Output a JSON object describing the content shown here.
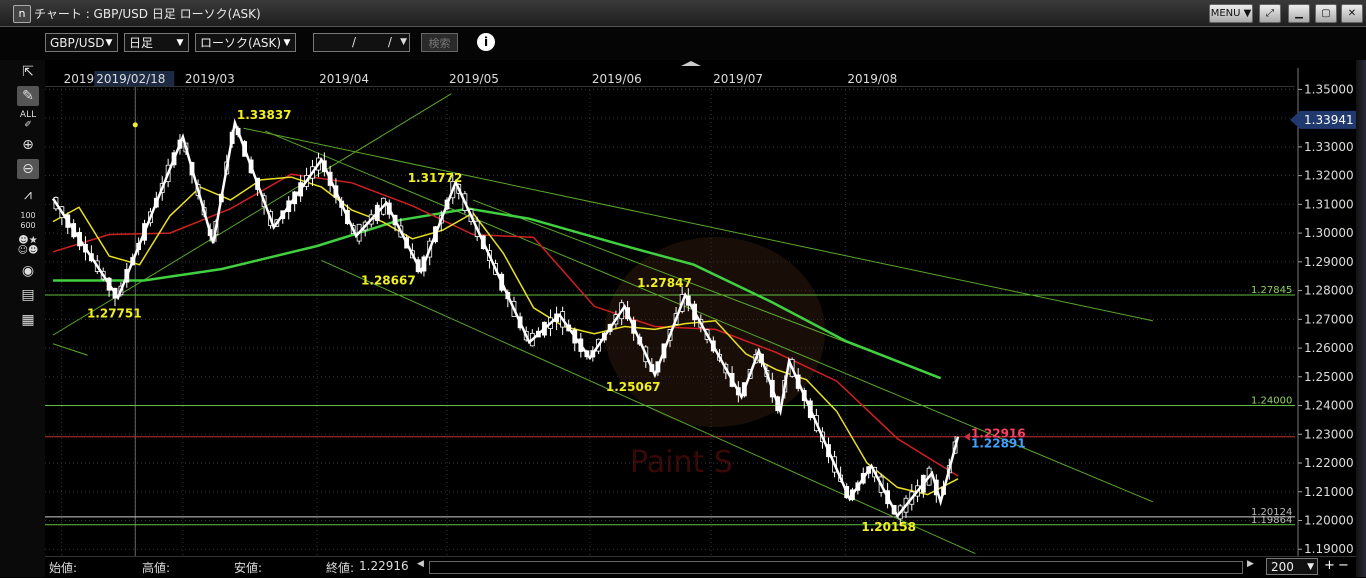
{
  "window": {
    "app_icon": "n",
    "title": "チャート : GBP/USD 日足 ローソク(ASK)",
    "menu_label": "MENU ▼",
    "buttons": [
      "pin-icon",
      "minimize-icon",
      "maximize-icon",
      "close-icon"
    ]
  },
  "toolbar": {
    "pair": "GBP/USD",
    "period": "日足",
    "chart_type": "ローソク(ASK)",
    "date_value": "/ /",
    "search_label": "検索",
    "info_label": "i"
  },
  "tools": [
    "cursor-icon",
    "pen-icon",
    "all-delete-icon",
    "zoom-in-icon",
    "zoom-out-icon",
    "indicator-icon",
    "value-table-icon",
    "compare-icon",
    "view-icon",
    "print-icon",
    "settings-grid-icon"
  ],
  "status": {
    "open_label": "始値:",
    "high_label": "高値:",
    "low_label": "安値:",
    "close_label": "終値:",
    "close_value": "1.22916",
    "zoom_value": "200"
  },
  "colors": {
    "candle": "#ffffff",
    "zigzag": "#ffffff",
    "ma_short": "#e8e020",
    "ma_mid": "#d02020",
    "ma_long": "#40d040",
    "trendline": "#5aa82a",
    "horizontal_line": "#60c040",
    "current_price_line": "#c03030",
    "price_label_bg": "#203a70",
    "peak_label": "#f0f020"
  },
  "chart_data": {
    "type": "candlestick",
    "y_range": [
      1.186,
      1.356
    ],
    "y_ticks": [
      "1.35000",
      "1.34000",
      "1.33000",
      "1.32000",
      "1.31000",
      "1.30000",
      "1.29000",
      "1.28000",
      "1.27000",
      "1.26000",
      "1.25000",
      "1.24000",
      "1.23000",
      "1.22000",
      "1.21000",
      "1.20000",
      "1.19000"
    ],
    "x_labels": [
      {
        "text": "2019",
        "date": "2019-02-01"
      },
      {
        "text": "2019/02/18",
        "date": "2019-02-18",
        "highlight": true
      },
      {
        "text": "2019/03",
        "date": "2019-03-01"
      },
      {
        "text": "2019/04",
        "date": "2019-04-01"
      },
      {
        "text": "2019/05",
        "date": "2019-05-01"
      },
      {
        "text": "2019/06",
        "date": "2019-06-03"
      },
      {
        "text": "2019/07",
        "date": "2019-07-01"
      },
      {
        "text": "2019/08",
        "date": "2019-08-01"
      }
    ],
    "zigzag": [
      {
        "date": "2019-01-30",
        "value": 1.312
      },
      {
        "date": "2019-02-14",
        "value": 1.27751
      },
      {
        "date": "2019-03-01",
        "value": 1.3335
      },
      {
        "date": "2019-03-08",
        "value": 1.2965
      },
      {
        "date": "2019-03-13",
        "value": 1.33837
      },
      {
        "date": "2019-03-22",
        "value": 1.302
      },
      {
        "date": "2019-04-02",
        "value": 1.3255
      },
      {
        "date": "2019-04-10",
        "value": 1.299
      },
      {
        "date": "2019-04-17",
        "value": 1.3105
      },
      {
        "date": "2019-04-25",
        "value": 1.28667
      },
      {
        "date": "2019-05-03",
        "value": 1.31772
      },
      {
        "date": "2019-05-20",
        "value": 1.262
      },
      {
        "date": "2019-05-27",
        "value": 1.2715
      },
      {
        "date": "2019-06-03",
        "value": 1.2565
      },
      {
        "date": "2019-06-11",
        "value": 1.2745
      },
      {
        "date": "2019-06-18",
        "value": 1.25067
      },
      {
        "date": "2019-06-25",
        "value": 1.27847
      },
      {
        "date": "2019-07-08",
        "value": 1.243
      },
      {
        "date": "2019-07-12",
        "value": 1.259
      },
      {
        "date": "2019-07-17",
        "value": 1.238
      },
      {
        "date": "2019-07-19",
        "value": 1.2555
      },
      {
        "date": "2019-08-02",
        "value": 1.2075
      },
      {
        "date": "2019-08-07",
        "value": 1.219
      },
      {
        "date": "2019-08-13",
        "value": 1.20158
      },
      {
        "date": "2019-08-21",
        "value": 1.2165
      },
      {
        "date": "2019-08-23",
        "value": 1.2065
      },
      {
        "date": "2019-08-27",
        "value": 1.22916
      }
    ],
    "ma_short": [
      {
        "date": "2019-01-30",
        "value": 1.304
      },
      {
        "date": "2019-02-05",
        "value": 1.309
      },
      {
        "date": "2019-02-12",
        "value": 1.292
      },
      {
        "date": "2019-02-19",
        "value": 1.289
      },
      {
        "date": "2019-02-26",
        "value": 1.306
      },
      {
        "date": "2019-03-05",
        "value": 1.316
      },
      {
        "date": "2019-03-12",
        "value": 1.3115
      },
      {
        "date": "2019-03-19",
        "value": 1.3185
      },
      {
        "date": "2019-03-26",
        "value": 1.3195
      },
      {
        "date": "2019-04-02",
        "value": 1.316
      },
      {
        "date": "2019-04-09",
        "value": 1.308
      },
      {
        "date": "2019-04-16",
        "value": 1.304
      },
      {
        "date": "2019-04-23",
        "value": 1.298
      },
      {
        "date": "2019-04-30",
        "value": 1.301
      },
      {
        "date": "2019-05-07",
        "value": 1.307
      },
      {
        "date": "2019-05-14",
        "value": 1.293
      },
      {
        "date": "2019-05-21",
        "value": 1.274
      },
      {
        "date": "2019-05-28",
        "value": 1.2675
      },
      {
        "date": "2019-06-04",
        "value": 1.265
      },
      {
        "date": "2019-06-11",
        "value": 1.2675
      },
      {
        "date": "2019-06-18",
        "value": 1.2665
      },
      {
        "date": "2019-06-25",
        "value": 1.2685
      },
      {
        "date": "2019-07-02",
        "value": 1.2695
      },
      {
        "date": "2019-07-09",
        "value": 1.258
      },
      {
        "date": "2019-07-16",
        "value": 1.2525
      },
      {
        "date": "2019-07-23",
        "value": 1.249
      },
      {
        "date": "2019-07-30",
        "value": 1.238
      },
      {
        "date": "2019-08-06",
        "value": 1.22
      },
      {
        "date": "2019-08-13",
        "value": 1.2115
      },
      {
        "date": "2019-08-20",
        "value": 1.209
      },
      {
        "date": "2019-08-27",
        "value": 1.2145
      }
    ],
    "ma_mid": [
      {
        "date": "2019-01-30",
        "value": 1.2935
      },
      {
        "date": "2019-02-12",
        "value": 1.2995
      },
      {
        "date": "2019-02-26",
        "value": 1.3
      },
      {
        "date": "2019-03-12",
        "value": 1.3085
      },
      {
        "date": "2019-03-26",
        "value": 1.3205
      },
      {
        "date": "2019-04-09",
        "value": 1.3175
      },
      {
        "date": "2019-04-23",
        "value": 1.3095
      },
      {
        "date": "2019-05-07",
        "value": 1.2995
      },
      {
        "date": "2019-05-21",
        "value": 1.2985
      },
      {
        "date": "2019-06-04",
        "value": 1.2745
      },
      {
        "date": "2019-06-18",
        "value": 1.2675
      },
      {
        "date": "2019-07-02",
        "value": 1.2665
      },
      {
        "date": "2019-07-16",
        "value": 1.2585
      },
      {
        "date": "2019-07-30",
        "value": 1.2485
      },
      {
        "date": "2019-08-13",
        "value": 1.2285
      },
      {
        "date": "2019-08-27",
        "value": 1.2155
      }
    ],
    "ma_long": [
      {
        "date": "2019-01-30",
        "value": 1.2835
      },
      {
        "date": "2019-02-20",
        "value": 1.2835
      },
      {
        "date": "2019-03-10",
        "value": 1.2875
      },
      {
        "date": "2019-04-01",
        "value": 1.2955
      },
      {
        "date": "2019-04-20",
        "value": 1.3045
      },
      {
        "date": "2019-05-06",
        "value": 1.3085
      },
      {
        "date": "2019-05-20",
        "value": 1.305
      },
      {
        "date": "2019-06-10",
        "value": 1.296
      },
      {
        "date": "2019-06-27",
        "value": 1.289
      },
      {
        "date": "2019-07-15",
        "value": 1.276
      },
      {
        "date": "2019-08-01",
        "value": 1.2625
      },
      {
        "date": "2019-08-23",
        "value": 1.2495
      }
    ],
    "trendlines": [
      {
        "start": {
          "date": "2019-01-30",
          "value": 1.2645
        },
        "end": {
          "date": "2019-05-02",
          "value": 1.3485
        }
      },
      {
        "start": {
          "date": "2019-03-15",
          "value": 1.3365
        },
        "end": {
          "date": "2019-10-11",
          "value": 1.2695
        }
      },
      {
        "start": {
          "date": "2019-03-20",
          "value": 1.3355
        },
        "end": {
          "date": "2019-10-11",
          "value": 1.2065
        }
      },
      {
        "start": {
          "date": "2019-04-02",
          "value": 1.2905
        },
        "end": {
          "date": "2019-08-31",
          "value": 1.1885
        }
      },
      {
        "start": {
          "date": "2019-05-07",
          "value": 1.3115
        },
        "end": {
          "date": "2019-08-23",
          "value": 1.2495
        }
      },
      {
        "start": {
          "date": "2019-01-30",
          "value": 1.2615
        },
        "end": {
          "date": "2019-02-07",
          "value": 1.2575
        }
      }
    ],
    "horizontal_lines": [
      {
        "value": 1.27845,
        "label": "1.27845"
      },
      {
        "value": 1.24,
        "label": "1.24000"
      },
      {
        "value": 1.20124,
        "label": "1.20124"
      },
      {
        "value": 1.1985,
        "label": "1.19864"
      }
    ],
    "current_price": {
      "value": 1.22916,
      "label": "1.22916"
    },
    "secondary_price": {
      "value": 1.22891,
      "label": "1.22891"
    },
    "axis_marker": {
      "value": 1.33941,
      "label": "1.33941"
    },
    "peak_labels": [
      {
        "text": "1.33837",
        "date": "2019-03-13",
        "value": 1.33837
      },
      {
        "text": "1.27751",
        "date": "2019-02-14",
        "value": 1.27751
      },
      {
        "text": "1.31772",
        "date": "2019-05-03",
        "value": 1.31772
      },
      {
        "text": "1.28667",
        "date": "2019-04-25",
        "value": 1.28667
      },
      {
        "text": "1.27847",
        "date": "2019-06-25",
        "value": 1.27847
      },
      {
        "text": "1.25067",
        "date": "2019-06-18",
        "value": 1.25067
      },
      {
        "text": "1.20158",
        "date": "2019-08-13",
        "value": 1.20158
      }
    ],
    "cursor_date": "2019-02-18",
    "watermark": "Paint S"
  }
}
